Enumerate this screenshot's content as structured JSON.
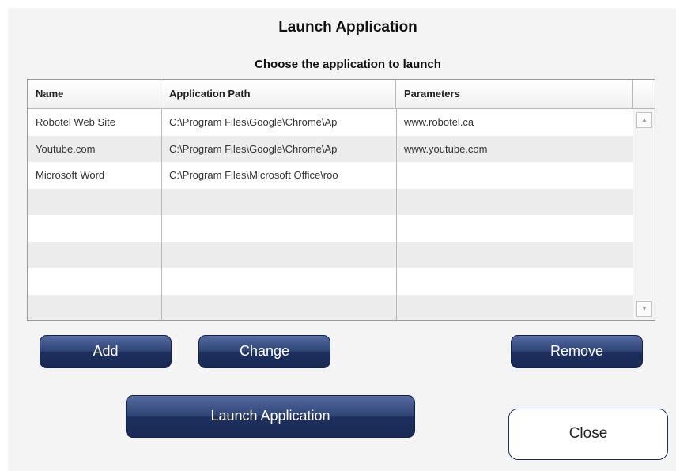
{
  "dialog": {
    "title": "Launch Application",
    "subtitle": "Choose the application to launch"
  },
  "table": {
    "columns": [
      "Name",
      "Application Path",
      "Parameters"
    ],
    "rows": [
      {
        "name": "Robotel Web Site",
        "path": "C:\\Program Files\\Google\\Chrome\\Ap",
        "params": "www.robotel.ca"
      },
      {
        "name": "Youtube.com",
        "path": "C:\\Program Files\\Google\\Chrome\\Ap",
        "params": "www.youtube.com"
      },
      {
        "name": "Microsoft Word",
        "path": "C:\\Program Files\\Microsoft Office\\roo",
        "params": ""
      },
      {
        "name": "",
        "path": "",
        "params": ""
      },
      {
        "name": "",
        "path": "",
        "params": ""
      },
      {
        "name": "",
        "path": "",
        "params": ""
      },
      {
        "name": "",
        "path": "",
        "params": ""
      },
      {
        "name": "",
        "path": "",
        "params": ""
      }
    ]
  },
  "buttons": {
    "add": "Add",
    "change": "Change",
    "remove": "Remove",
    "launch": "Launch Application",
    "close": "Close"
  },
  "icons": {
    "scroll_up": "chevron-up-icon",
    "scroll_down": "chevron-down-icon"
  },
  "colors": {
    "button_primary": "#2f4476",
    "close_border": "#1f2e57"
  }
}
